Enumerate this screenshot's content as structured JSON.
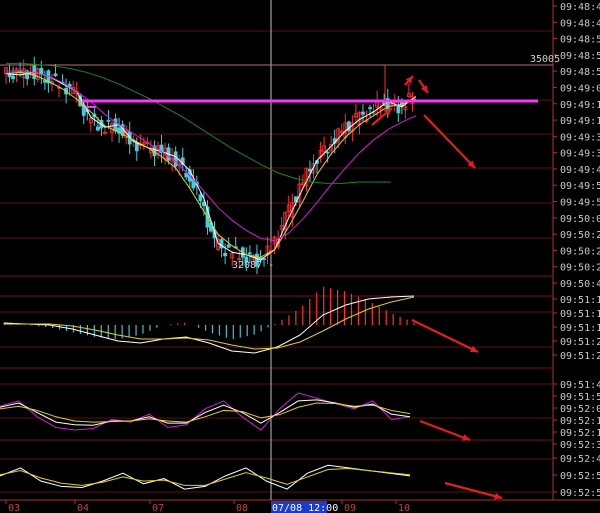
{
  "chart_data": [
    {
      "type": "candlestick",
      "panel": "price",
      "high_label": "35005",
      "low_label": "32087",
      "horizontal_line_color": "#ff33ff",
      "series": [
        {
          "name": "",
          "color": "#ffffff",
          "values": [
            31.8,
            31.7,
            31.9,
            31.6,
            31.0,
            30.4,
            28.4,
            27.6,
            27.8,
            26.5,
            26.0,
            25.7,
            25.3,
            24.2,
            22.0,
            18.5,
            17.8,
            17.6,
            17.2,
            18.0,
            20.5,
            22.8,
            25.0,
            26.1,
            27.3,
            28.2,
            28.8,
            29.6,
            29.2,
            30.0
          ]
        },
        {
          "name": "",
          "color": "#e0d020",
          "values": [
            31.8,
            31.9,
            31.7,
            31.2,
            30.6,
            29.8,
            28.8,
            27.7,
            27.2,
            26.6,
            26.0,
            25.3,
            24.4,
            22.8,
            21.0,
            19.2,
            18.3,
            17.6,
            17.4,
            18.0,
            19.8,
            21.8,
            23.9,
            25.5,
            26.8,
            27.8,
            28.5,
            29.2,
            29.4,
            29.8
          ]
        },
        {
          "name": "",
          "color": "#d020d0",
          "values": [
            32.0,
            32.0,
            31.9,
            31.6,
            31.1,
            30.4,
            29.6,
            28.6,
            27.8,
            27.1,
            26.4,
            25.7,
            24.9,
            23.8,
            22.6,
            21.3,
            20.3,
            19.5,
            18.9,
            18.7,
            19.3,
            20.4,
            21.7,
            23.1,
            24.4,
            25.6,
            26.6,
            27.4,
            28.0,
            28.5
          ]
        },
        {
          "name": "",
          "color": "#208020",
          "values": [
            32.6,
            32.6,
            32.5,
            32.4,
            32.2,
            31.9,
            31.5,
            31.0,
            30.4,
            29.8,
            29.1,
            28.4,
            27.6,
            26.8,
            26.0,
            25.3,
            24.6,
            24.0,
            23.6,
            23.3,
            23.2,
            23.2,
            23.3,
            23.3,
            23.3
          ]
        }
      ],
      "x_tick_labels": [
        "03",
        "04",
        "07",
        "08",
        "07/08 12:00",
        "09",
        "10"
      ],
      "y_tick_labels": [
        "09:48:4",
        "09:48:4",
        "09:48:5",
        "09:48:5",
        "09:48:5",
        "09:49:0",
        "09:49:1",
        "09:49:1",
        "09:49:3",
        "09:49:3",
        "09:49:4",
        "09:49:5",
        "09:49:5",
        "09:50:0",
        "09:50:2",
        "09:50:2",
        "09:50:2",
        "09:50:4"
      ]
    },
    {
      "type": "bar",
      "panel": "macd",
      "series": [
        {
          "name": "",
          "color": "#ffffff",
          "values": [
            0.2,
            0.1,
            0.0,
            -0.4,
            -1.0,
            -1.6,
            -1.8,
            -1.4,
            -1.2,
            -1.8,
            -2.6,
            -2.8,
            -2.2,
            -1.0,
            1.0,
            2.0,
            2.6,
            2.8,
            2.9
          ]
        },
        {
          "name": "",
          "color": "#e0d020",
          "values": [
            0.1,
            0.1,
            0.1,
            -0.1,
            -0.5,
            -1.0,
            -1.4,
            -1.4,
            -1.3,
            -1.5,
            -2.0,
            -2.4,
            -2.3,
            -1.7,
            -0.6,
            0.6,
            1.6,
            2.3,
            2.8
          ]
        }
      ],
      "y_tick_labels": [
        "09:51:1",
        "09:51:1",
        "09:51:1",
        "09:51:2",
        "09:51:2"
      ]
    },
    {
      "type": "line",
      "panel": "kdj",
      "series": [
        {
          "name": "",
          "color": "#d020d0",
          "values": [
            60,
            70,
            40,
            20,
            15,
            18,
            35,
            30,
            45,
            20,
            25,
            55,
            70,
            40,
            15,
            55,
            85,
            75,
            65,
            55,
            70,
            35,
            40
          ]
        },
        {
          "name": "",
          "color": "#ffffff",
          "values": [
            58,
            66,
            48,
            30,
            25,
            24,
            32,
            32,
            40,
            28,
            28,
            48,
            62,
            48,
            28,
            48,
            70,
            72,
            66,
            58,
            64,
            45,
            40
          ]
        },
        {
          "name": "",
          "color": "#e0d020",
          "values": [
            55,
            60,
            52,
            40,
            32,
            30,
            31,
            32,
            36,
            32,
            30,
            40,
            52,
            50,
            38,
            44,
            58,
            66,
            65,
            60,
            62,
            52,
            46
          ]
        }
      ],
      "y_tick_labels": [
        "09:51:4",
        "09:51:5",
        "09:52:0",
        "09:52:1",
        "09:52:1",
        "09:52:3"
      ]
    },
    {
      "type": "line",
      "panel": "rsi",
      "series": [
        {
          "name": "",
          "color": "#ffffff",
          "values": [
            40,
            55,
            30,
            20,
            18,
            30,
            45,
            25,
            35,
            15,
            20,
            40,
            55,
            30,
            15,
            45,
            60,
            55,
            50,
            45,
            40
          ]
        },
        {
          "name": "",
          "color": "#e0d020",
          "values": [
            42,
            50,
            36,
            26,
            22,
            28,
            38,
            30,
            32,
            22,
            22,
            34,
            46,
            36,
            24,
            38,
            52,
            54,
            50,
            46,
            42
          ]
        }
      ],
      "y_tick_labels": [
        "09:52:4",
        "09:52:5",
        "09:52:5"
      ]
    }
  ]
}
